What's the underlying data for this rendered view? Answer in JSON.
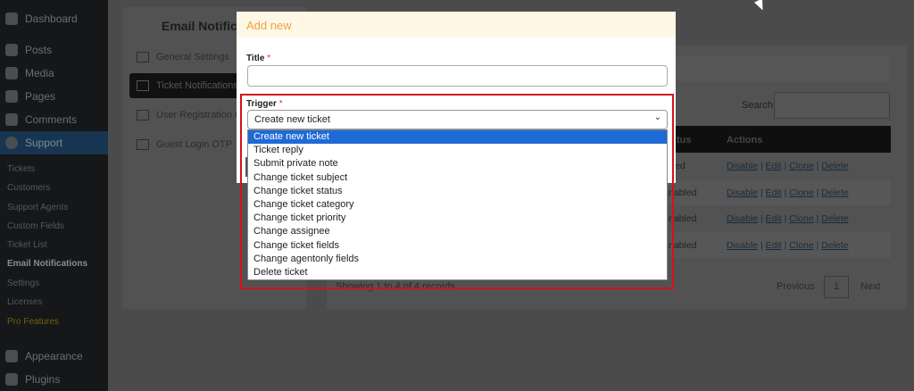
{
  "sidebar": {
    "menu": [
      {
        "label": "Dashboard",
        "icon": "dashboard-icon"
      },
      {
        "label": "Posts",
        "icon": "pin-icon"
      },
      {
        "label": "Media",
        "icon": "media-icon"
      },
      {
        "label": "Pages",
        "icon": "pages-icon"
      },
      {
        "label": "Comments",
        "icon": "comment-icon"
      },
      {
        "label": "Support",
        "icon": "support-icon"
      }
    ],
    "submenu": [
      "Tickets",
      "Customers",
      "Support Agents",
      "Custom Fields",
      "Ticket List",
      "Email Notifications",
      "Settings",
      "Licenses",
      "Pro Features"
    ],
    "bottom": [
      {
        "label": "Appearance",
        "icon": "brush-icon"
      },
      {
        "label": "Plugins",
        "icon": "plugin-icon"
      }
    ]
  },
  "left_panel": {
    "title": "Email Notifica",
    "items": [
      {
        "label": "General Settings",
        "icon": "sliders-icon"
      },
      {
        "label": "Ticket Notifications",
        "icon": "envelope-icon"
      },
      {
        "label": "User Registration O",
        "icon": "sitemap-icon"
      },
      {
        "label": "Guest Login OTP",
        "icon": "sitemap-icon"
      }
    ]
  },
  "table": {
    "search_label": "Search:",
    "headers": {
      "status": "tus",
      "actions": "Actions"
    },
    "rows": [
      {
        "status": "abled"
      },
      {
        "status": "Enabled"
      },
      {
        "status": "Enabled"
      },
      {
        "status": "Enabled"
      }
    ],
    "actions": {
      "disable": "Disable",
      "edit": "Edit",
      "clone": "Clone",
      "delete": "Delete",
      "sep": "|"
    },
    "showing": "Showing 1 to 4 of 4 records",
    "pagination": {
      "previous": "Previous",
      "page": "1",
      "next": "Next"
    }
  },
  "modal": {
    "title": "Add new",
    "title_label": "Title",
    "title_value": "",
    "trigger_label": "Trigger",
    "required_mark": "*",
    "trigger_value": "Create new ticket",
    "options": [
      "Create new ticket",
      "Ticket reply",
      "Submit private note",
      "Change ticket subject",
      "Change ticket status",
      "Change ticket category",
      "Change ticket priority",
      "Change assignee",
      "Change ticket fields",
      "Change agentonly fields",
      "Delete ticket"
    ]
  },
  "colors": {
    "accent": "#1e6ad6",
    "highlight": "#d3121c",
    "modal_header": "#fef7e6",
    "modal_title": "#f0a23a"
  }
}
